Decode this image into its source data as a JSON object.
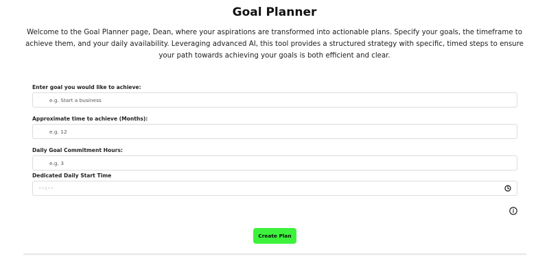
{
  "header": {
    "title": "Goal Planner",
    "intro": "Welcome to the Goal Planner page, Dean, where your aspirations are transformed into actionable plans. Specify your goals, the timeframe to achieve them, and your daily availability. Leveraging advanced AI, this tool provides a structured strategy with specific, timed steps to ensure your path towards achieving your goals is both efficient and clear."
  },
  "form": {
    "goal": {
      "label": "Enter goal you would like to achieve:",
      "placeholder": "e.g. Start a business"
    },
    "time": {
      "label": "Approximate time to achieve (Months):",
      "placeholder": "e.g. 12"
    },
    "hours": {
      "label": "Daily Goal Commitment Hours:",
      "placeholder": "e.g. 3"
    },
    "start_time": {
      "label": "Dedicated Daily Start Time",
      "value": "--:--"
    }
  },
  "actions": {
    "create_label": "Create Plan"
  },
  "colors": {
    "button": "#3df23d",
    "border": "#dcdcdc"
  },
  "icons": [
    "clock-icon",
    "info-icon"
  ]
}
